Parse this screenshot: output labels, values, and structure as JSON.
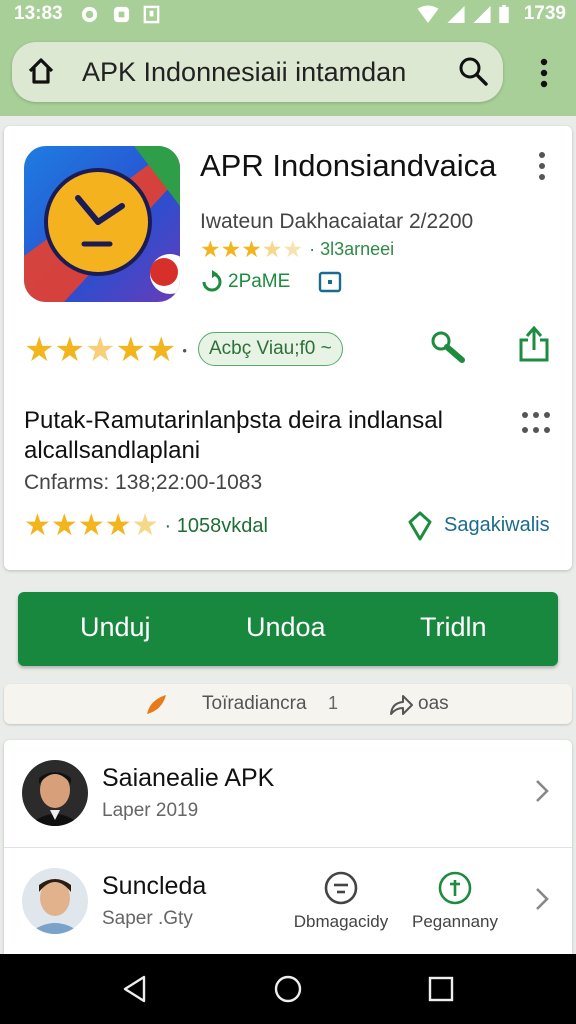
{
  "status_bar": {
    "time_left": "13:83",
    "time_right": "1739"
  },
  "search": {
    "text": "APK Indonnesiaii intamdan"
  },
  "app": {
    "title": "APR Indonsiandvaica",
    "developer": "Iwateun Dakhacaiatar 2/2200",
    "rating_count_small": "· 3l3arneei",
    "badge_label": "2PaME",
    "pill_label": "Acbç Viau;f0 ~",
    "description": "Putak-Ramutarinlanþsta deira indlansal alcallsandlaplani",
    "confirms": "Cnfarms: 138;22:00-1083",
    "rating_count_big": "· 1058vkdal",
    "safety_label": "Sagakiwalis"
  },
  "actions": {
    "left": "Unduj",
    "middle": "Undoa",
    "right": "Tridln"
  },
  "strip": {
    "label": "Toïradiancra",
    "count": "1",
    "share_label": "oas"
  },
  "list": [
    {
      "title": "Saianealie APK",
      "subtitle": "Laper 2019"
    },
    {
      "title": "Suncleda",
      "subtitle": "Saper .Gty",
      "action_1": "Dbmagacidy",
      "action_2": "Pegannany"
    }
  ],
  "colors": {
    "accent_green": "#17883e",
    "star_yellow": "#f2b51e",
    "top_area": "#a9cf98"
  }
}
